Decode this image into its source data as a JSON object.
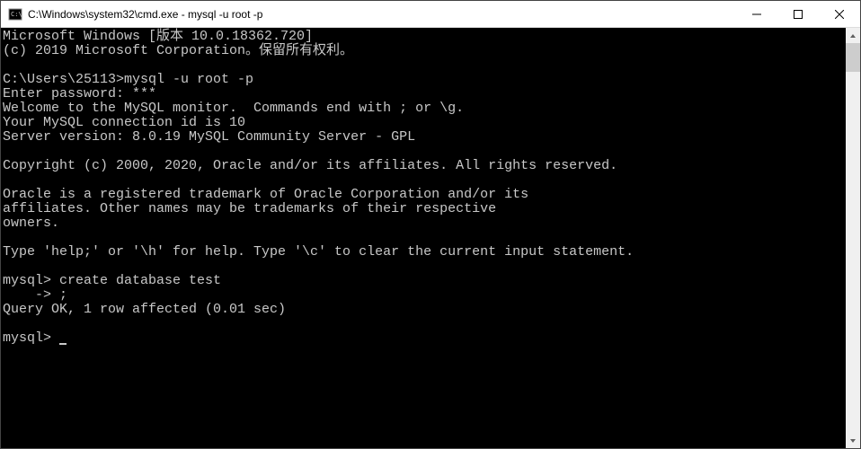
{
  "titlebar": {
    "title": "C:\\Windows\\system32\\cmd.exe - mysql  -u root -p"
  },
  "terminal": {
    "lines": [
      "Microsoft Windows [版本 10.0.18362.720]",
      "(c) 2019 Microsoft Corporation。保留所有权利。",
      "",
      "C:\\Users\\25113>mysql -u root -p",
      "Enter password: ***",
      "Welcome to the MySQL monitor.  Commands end with ; or \\g.",
      "Your MySQL connection id is 10",
      "Server version: 8.0.19 MySQL Community Server - GPL",
      "",
      "Copyright (c) 2000, 2020, Oracle and/or its affiliates. All rights reserved.",
      "",
      "Oracle is a registered trademark of Oracle Corporation and/or its",
      "affiliates. Other names may be trademarks of their respective",
      "owners.",
      "",
      "Type 'help;' or '\\h' for help. Type '\\c' to clear the current input statement.",
      "",
      "mysql> create database test",
      "    -> ;",
      "Query OK, 1 row affected (0.01 sec)",
      "",
      "mysql>"
    ]
  }
}
